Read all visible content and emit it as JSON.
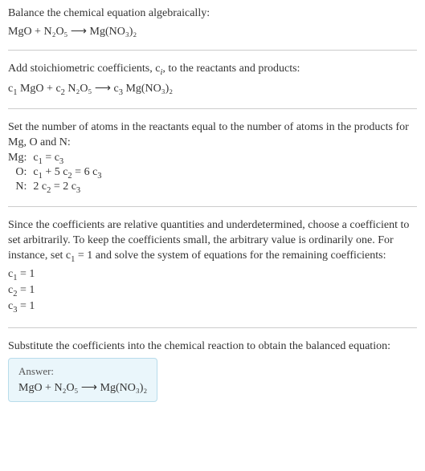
{
  "intro": {
    "line1": "Balance the chemical equation algebraically:",
    "eq": "MgO + N₂O₅ ⟶ Mg(NO₃)₂"
  },
  "step1": {
    "text_a": "Add stoichiometric coefficients, ",
    "ci": "c",
    "ci_sub": "i",
    "text_b": ", to the reactants and products:",
    "eq_parts": {
      "c1": "c",
      "c1s": "1",
      "r1": " MgO + ",
      "c2": "c",
      "c2s": "2",
      "r2": " N₂O₅ ⟶ ",
      "c3": "c",
      "c3s": "3",
      "r3": " Mg(NO₃)₂"
    }
  },
  "step2": {
    "text": "Set the number of atoms in the reactants equal to the number of atoms in the products for Mg, O and N:",
    "rows": [
      {
        "label": "Mg:",
        "eq_html": "c<sub>1</sub> = c<sub>3</sub>"
      },
      {
        "label": "O:",
        "eq_html": "c<sub>1</sub> + 5 c<sub>2</sub> = 6 c<sub>3</sub>"
      },
      {
        "label": "N:",
        "eq_html": "2 c<sub>2</sub> = 2 c<sub>3</sub>"
      }
    ]
  },
  "step3": {
    "text_html": "Since the coefficients are relative quantities and underdetermined, choose a coefficient to set arbitrarily. To keep the coefficients small, the arbitrary value is ordinarily one. For instance, set c<sub>1</sub> = 1 and solve the system of equations for the remaining coefficients:",
    "coeffs": [
      "c<sub>1</sub> = 1",
      "c<sub>2</sub> = 1",
      "c<sub>3</sub> = 1"
    ]
  },
  "step4": {
    "text": "Substitute the coefficients into the chemical reaction to obtain the balanced equation:"
  },
  "answer": {
    "label": "Answer:",
    "eq": "MgO + N₂O₅ ⟶ Mg(NO₃)₂"
  }
}
